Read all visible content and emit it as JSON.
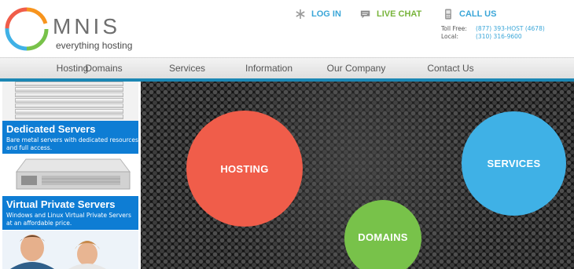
{
  "brand": {
    "name": "MNIS",
    "tagline": "everything hosting"
  },
  "top_links": {
    "login": "LOG IN",
    "chat": "LIVE CHAT",
    "call": "CALL US"
  },
  "phones": {
    "toll_free_label": "Toll Free:",
    "toll_free_number": "(877) 393-HOST (4678)",
    "local_label": "Local:",
    "local_number": "(310) 316-9600"
  },
  "nav": {
    "items": [
      "Hosting",
      "Domains",
      "Services",
      "Information",
      "Our Company",
      "Contact Us"
    ]
  },
  "promos": [
    {
      "title": "Dedicated Servers",
      "desc": "Bare metal servers with dedicated resources and full access."
    },
    {
      "title": "Virtual Private Servers",
      "desc": "Windows and Linux Virtual Private Servers at an affordable price."
    }
  ],
  "hero": {
    "hosting": "HOSTING",
    "services": "SERVICES",
    "domains": "DOMAINS"
  },
  "colors": {
    "accent_blue": "#3aa6d8",
    "green": "#78b43b",
    "nav_bar": "#1b87b4",
    "hosting": "#f05d4a",
    "services": "#3fb1e6",
    "domains": "#78c24a",
    "promo_box": "#0e7dd4"
  }
}
